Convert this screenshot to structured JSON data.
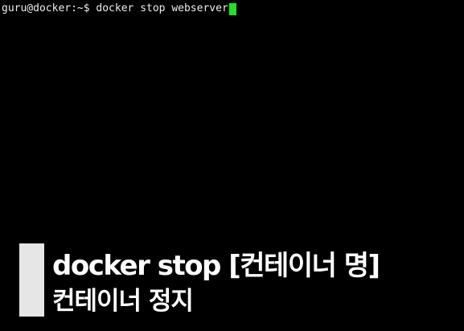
{
  "terminal": {
    "prompt": "guru@docker:~$ ",
    "command": "docker stop webserver",
    "cursor_color": "#22e022",
    "background_color": "#000000",
    "text_color": "#ececec"
  },
  "caption": {
    "title": "docker stop [컨테이너 명]",
    "subtitle": "컨테이너 정지",
    "bar_color": "#e6e6e6",
    "text_color": "#ffffff"
  }
}
